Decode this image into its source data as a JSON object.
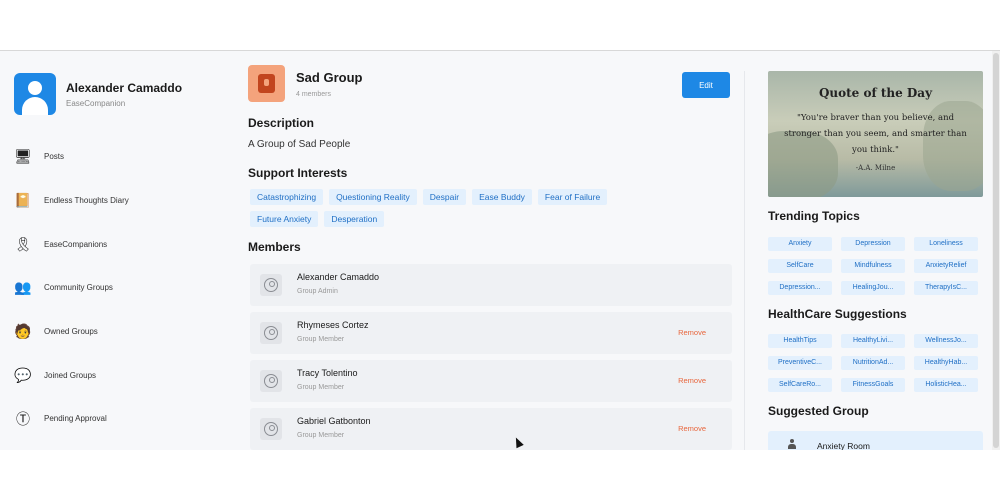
{
  "profile": {
    "name": "Alexander Camaddo",
    "subtitle": "EaseCompanion"
  },
  "sidebar": {
    "items": [
      {
        "label": "Posts",
        "icon": "monitor-icon",
        "glyph": "🖥"
      },
      {
        "label": "Endless Thoughts Diary",
        "icon": "diary-icon",
        "glyph": "📔"
      },
      {
        "label": "EaseCompanions",
        "icon": "ribbon-icon",
        "glyph": "🎗"
      },
      {
        "label": "Community Groups",
        "icon": "community-icon",
        "glyph": "👥"
      },
      {
        "label": "Owned Groups",
        "icon": "owner-icon",
        "glyph": "🧑"
      },
      {
        "label": "Joined Groups",
        "icon": "joined-icon",
        "glyph": "💬"
      },
      {
        "label": "Pending Approval",
        "icon": "pending-icon",
        "glyph": "Ⓣ"
      }
    ]
  },
  "group": {
    "title": "Sad Group",
    "member_count": "4 members",
    "edit_label": "Edit",
    "description_title": "Description",
    "description": "A Group of Sad People",
    "interests_title": "Support Interests",
    "interests": [
      "Catastrophizing",
      "Questioning Reality",
      "Despair",
      "Ease Buddy",
      "Fear of Failure",
      "Future Anxiety",
      "Desperation"
    ],
    "members_title": "Members",
    "members": [
      {
        "name": "Alexander Camaddo",
        "role": "Group Admin",
        "action": ""
      },
      {
        "name": "Rhymeses Cortez",
        "role": "Group Member",
        "action": "Remove"
      },
      {
        "name": "Tracy Tolentino",
        "role": "Group Member",
        "action": "Remove"
      },
      {
        "name": "Gabriel Gatbonton",
        "role": "Group Member",
        "action": "Remove"
      }
    ]
  },
  "quote": {
    "title": "Quote of the Day",
    "text": "\"You're braver than you believe, and stronger than you seem, and smarter than you think.\"",
    "author": "-A.A. Milne"
  },
  "trending": {
    "title": "Trending Topics",
    "tags": [
      "Anxiety",
      "Depression",
      "Loneliness",
      "SelfCare",
      "Mindfulness",
      "AnxietyRelief",
      "Depression...",
      "HealingJou...",
      "TherapyIsC..."
    ]
  },
  "healthcare": {
    "title": "HealthCare Suggestions",
    "tags": [
      "HealthTips",
      "HealthyLivi...",
      "WellnessJo...",
      "PreventiveC...",
      "NutritionAd...",
      "HealthyHab...",
      "SelfCareRo...",
      "FitnessGoals",
      "HolisticHea..."
    ]
  },
  "suggested": {
    "title": "Suggested Group",
    "group_name": "Anxiety Room"
  },
  "colors": {
    "accent": "#1e88e5",
    "chip_bg": "#e3f0fd",
    "chip_text": "#1f6fc5",
    "remove": "#e8663d"
  }
}
